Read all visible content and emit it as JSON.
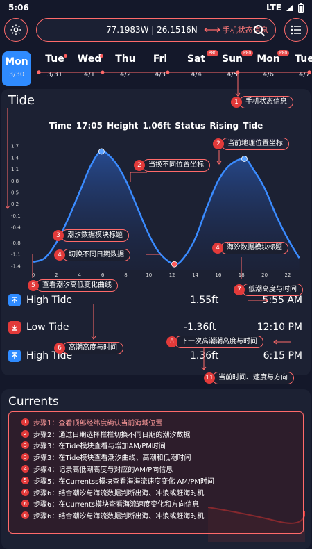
{
  "status_bar": {
    "time": "5:06",
    "network": "LTE"
  },
  "search": {
    "coords": "77.1983W | 26.1516N",
    "annotation": "手机状态信息"
  },
  "days": [
    {
      "name": "Mon",
      "date": "3/30",
      "selected": true
    },
    {
      "name": "Tue",
      "date": "3/31"
    },
    {
      "name": "Wed",
      "date": "4/1"
    },
    {
      "name": "Thu",
      "date": "4/2"
    },
    {
      "name": "Fri",
      "date": "4/3"
    },
    {
      "name": "Sat",
      "date": "4/4",
      "badge": "P80"
    },
    {
      "name": "Sun",
      "date": "4/5",
      "badge": "P80"
    },
    {
      "name": "Mon",
      "date": "4/6",
      "badge": "P80"
    },
    {
      "name": "Tue",
      "date": "4/7"
    }
  ],
  "tide": {
    "title": "Tide",
    "info": "Time 17:05   Height 1.06ft   Status Rising Tide",
    "rows": [
      {
        "type": "high",
        "label": "High Tide",
        "value": "1.55ft",
        "time": "5:55 AM"
      },
      {
        "type": "low",
        "label": "Low Tide",
        "value": "-1.36ft",
        "time": "12:10 PM"
      },
      {
        "type": "high",
        "label": "High Tide",
        "value": "1.36ft",
        "time": "6:15 PM"
      }
    ]
  },
  "chart_data": {
    "type": "area",
    "x": [
      0,
      1,
      2,
      3,
      4,
      5,
      5.9,
      7,
      8,
      9,
      10,
      11,
      12.2,
      13,
      14,
      15,
      16,
      17,
      18.25,
      19,
      20,
      21,
      22,
      23
    ],
    "y": [
      -1.3,
      -1.2,
      -0.8,
      -0.2,
      0.5,
      1.2,
      1.55,
      1.3,
      0.8,
      0.1,
      -0.6,
      -1.1,
      -1.36,
      -1.2,
      -0.7,
      0.1,
      0.8,
      1.2,
      1.36,
      1.1,
      0.6,
      -0.1,
      -0.7,
      -1.2
    ],
    "xticks": [
      "0",
      "2",
      "4",
      "6",
      "8",
      "10",
      "12",
      "14",
      "16",
      "18",
      "20",
      "22"
    ],
    "yticks": [
      "1.7",
      "1.4",
      "1.1",
      "0.8",
      "0.5",
      "0.2",
      "-0.1",
      "-0.4",
      "-0.8",
      "-1.1",
      "-1.4"
    ],
    "ylim": [
      -1.5,
      1.8
    ],
    "xlim": [
      0,
      23.5
    ],
    "highlights": [
      {
        "x": 5.9,
        "y": 1.55
      },
      {
        "x": 12.2,
        "y": -1.36
      },
      {
        "x": 18.25,
        "y": 1.36
      }
    ],
    "line_color": "#3a8bff"
  },
  "currents": {
    "title": "Currents"
  },
  "steps": [
    {
      "num": "1",
      "text": "步骤1：查看顶部经纬度确认当前海域位置"
    },
    {
      "num": "2",
      "text": "步骤2：通过日期选择栏栏切换不同日期的潮汐数据"
    },
    {
      "num": "3",
      "text": "步骤3：在Tide模块查看与增加AM/PM时间"
    },
    {
      "num": "3",
      "text": "步骤3：在Tide模块查看潮汐曲线、高潮和低潮时间"
    },
    {
      "num": "4",
      "text": "步骤4：记录高低潮高度与对应的AM/P向信息"
    },
    {
      "num": "5",
      "text": "步骤5：在Currentss模块查看海海流速度变化 AM/PM时间"
    },
    {
      "num": "6",
      "text": "步骤6：结合潮汐与海流数据判断出海、冲浪或赶海时机"
    },
    {
      "num": "6",
      "text": "步骤6：在Currents模块查看海流速度变化和方向信息"
    },
    {
      "num": "6",
      "text": "步骤6：结合潮汐与海流数据判断出海、冲浪或赶海时机"
    }
  ],
  "callouts": [
    {
      "num": "1",
      "text": "手机状态信息"
    },
    {
      "num": "2",
      "text": "当前地理位置坐标"
    },
    {
      "num": "2",
      "text": "当换不同位置坐标"
    },
    {
      "num": "3",
      "text": "潮汐数据模块标题"
    },
    {
      "num": "4",
      "text": "切换不同日期数据"
    },
    {
      "num": "4",
      "text": "海汐数据模块标题"
    },
    {
      "num": "5",
      "text": "查看潮汐高低变化曲线"
    },
    {
      "num": "7",
      "text": "低潮高度与时间"
    },
    {
      "num": "6",
      "text": "高潮高度与时间"
    },
    {
      "num": "8",
      "text": "下一次高潮潮高度与时间"
    },
    {
      "num": "11",
      "text": "当前时间、速度与方向"
    }
  ],
  "colors": {
    "accent": "#2f8bff",
    "annotation": "#ff6a6a",
    "background": "#14182a",
    "card": "#1c2133"
  }
}
